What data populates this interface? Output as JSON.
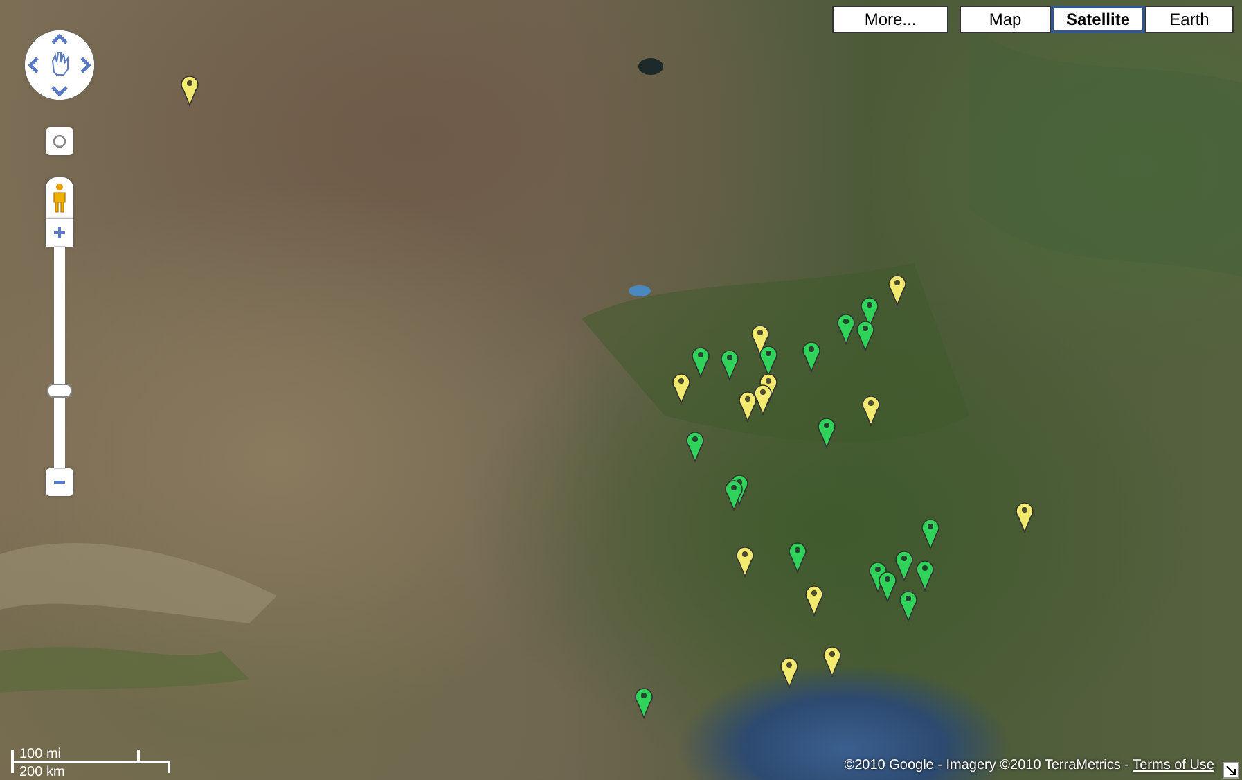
{
  "map_type_buttons": [
    {
      "label": "More...",
      "selected": false
    },
    {
      "label": "Map",
      "selected": false
    },
    {
      "label": "Satellite",
      "selected": true
    },
    {
      "label": "Earth",
      "selected": false
    }
  ],
  "zoom_slider": {
    "level": 0.34
  },
  "markers": [
    {
      "color": "#f2ea6e"
    },
    {
      "color": "#f2ea6e"
    },
    {
      "color": "#2fd35a"
    },
    {
      "color": "#2fd35a"
    },
    {
      "color": "#2fd35a"
    },
    {
      "color": "#f2ea6e"
    },
    {
      "color": "#2fd35a"
    },
    {
      "color": "#2fd35a"
    },
    {
      "color": "#2fd35a"
    },
    {
      "color": "#2fd35a"
    },
    {
      "color": "#f2ea6e"
    },
    {
      "color": "#f2ea6e"
    },
    {
      "color": "#f2ea6e"
    },
    {
      "color": "#f2ea6e"
    },
    {
      "color": "#f2ea6e"
    },
    {
      "color": "#2fd35a"
    },
    {
      "color": "#2fd35a"
    },
    {
      "color": "#2fd35a"
    },
    {
      "color": "#2fd35a"
    },
    {
      "color": "#f2ea6e"
    },
    {
      "color": "#2fd35a"
    },
    {
      "color": "#2fd35a"
    },
    {
      "color": "#f2ea6e"
    },
    {
      "color": "#2fd35a"
    },
    {
      "color": "#2fd35a"
    },
    {
      "color": "#2fd35a"
    },
    {
      "color": "#2fd35a"
    },
    {
      "color": "#f2ea6e"
    },
    {
      "color": "#2fd35a"
    },
    {
      "color": "#f2ea6e"
    },
    {
      "color": "#f2ea6e"
    },
    {
      "color": "#2fd35a"
    }
  ],
  "scale": {
    "miles": "100 mi",
    "kilometers": "200 km"
  },
  "copyright": {
    "text": "©2010 Google - Imagery ©2010 TerraMetrics - ",
    "link": "Terms of Use"
  }
}
